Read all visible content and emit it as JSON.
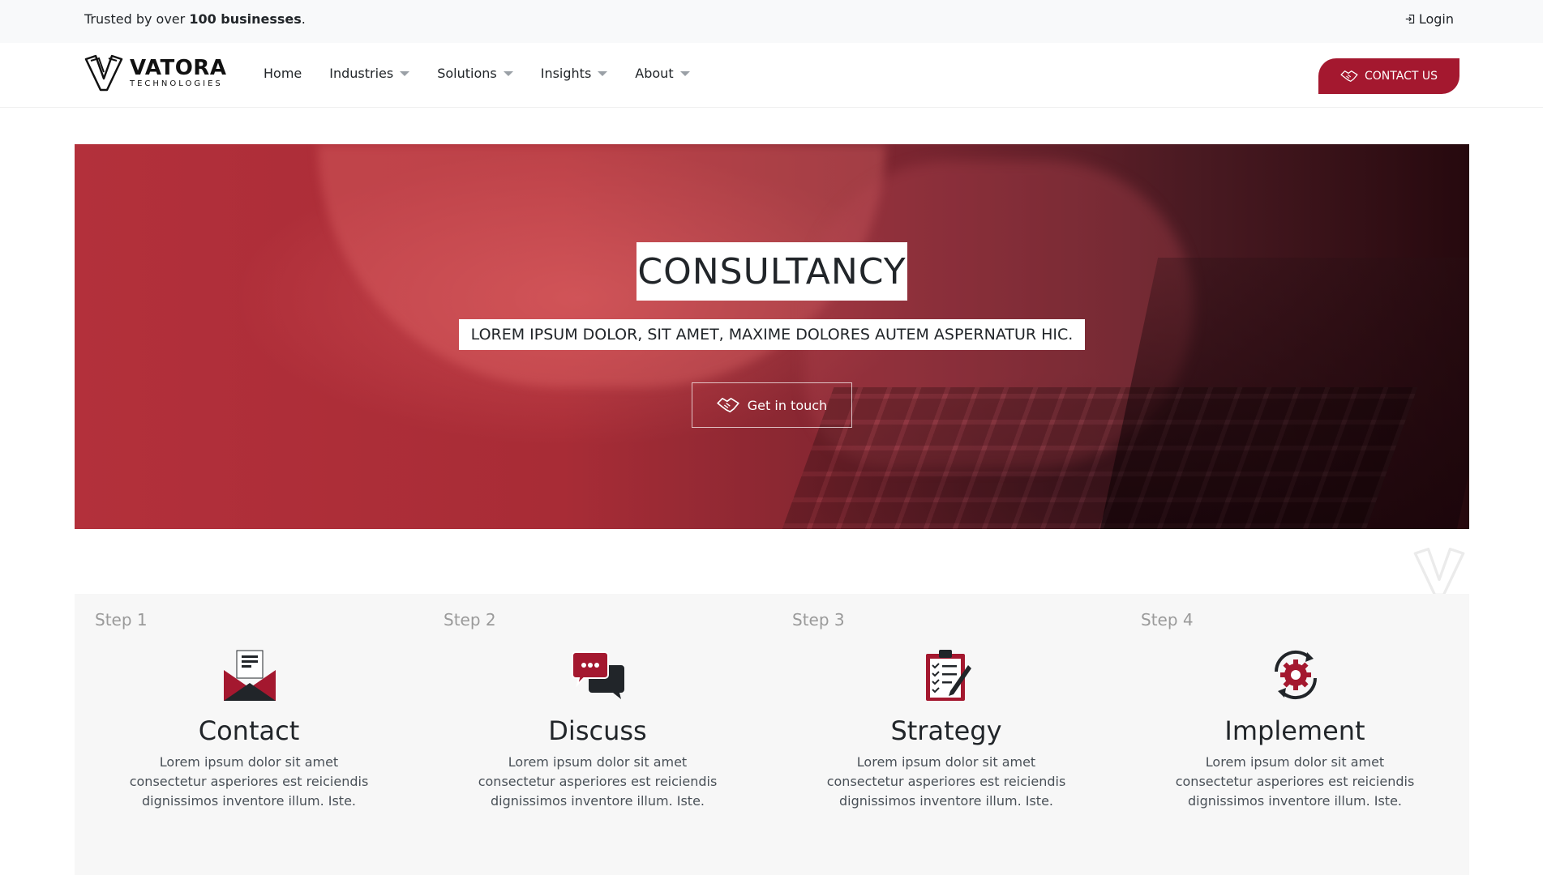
{
  "topbar": {
    "trusted_prefix": "Trusted by over ",
    "trusted_bold": "100 businesses",
    "trusted_suffix": ".",
    "login_label": "Login",
    "login_icon": "sign-in-icon"
  },
  "logo": {
    "brand": "VATORA",
    "sub": "TECHNOLOGIES"
  },
  "nav": {
    "items": [
      {
        "label": "Home",
        "has_dropdown": false
      },
      {
        "label": "Industries",
        "has_dropdown": true
      },
      {
        "label": "Solutions",
        "has_dropdown": true
      },
      {
        "label": "Insights",
        "has_dropdown": true
      },
      {
        "label": "About",
        "has_dropdown": true
      }
    ],
    "contact_label": "CONTACT US",
    "contact_icon": "handshake-icon"
  },
  "hero": {
    "title": "CONSULTANCY",
    "subtitle": "LOREM IPSUM DOLOR, SIT AMET, MAXIME DOLORES AUTEM ASPERNATUR HIC.",
    "cta_label": "Get in touch",
    "cta_icon": "handshake-icon"
  },
  "steps": [
    {
      "label": "Step 1",
      "title": "Contact",
      "icon": "open-envelope-icon",
      "desc": "Lorem ipsum dolor sit amet consectetur asperiores est reiciendis dignissimos inventore illum. Iste."
    },
    {
      "label": "Step 2",
      "title": "Discuss",
      "icon": "chat-bubbles-icon",
      "desc": "Lorem ipsum dolor sit amet consectetur asperiores est reiciendis dignissimos inventore illum. Iste."
    },
    {
      "label": "Step 3",
      "title": "Strategy",
      "icon": "clipboard-checklist-icon",
      "desc": "Lorem ipsum dolor sit amet consectetur asperiores est reiciendis dignissimos inventore illum. Iste."
    },
    {
      "label": "Step 4",
      "title": "Implement",
      "icon": "gear-cycle-icon",
      "desc": "Lorem ipsum dolor sit amet consectetur asperiores est reiciendis dignissimos inventore illum. Iste."
    }
  ],
  "colors": {
    "brand_red": "#a4182f",
    "topbar_bg": "#f8f9fa",
    "steps_bg": "#f7f7f7",
    "dark": "#212529"
  }
}
